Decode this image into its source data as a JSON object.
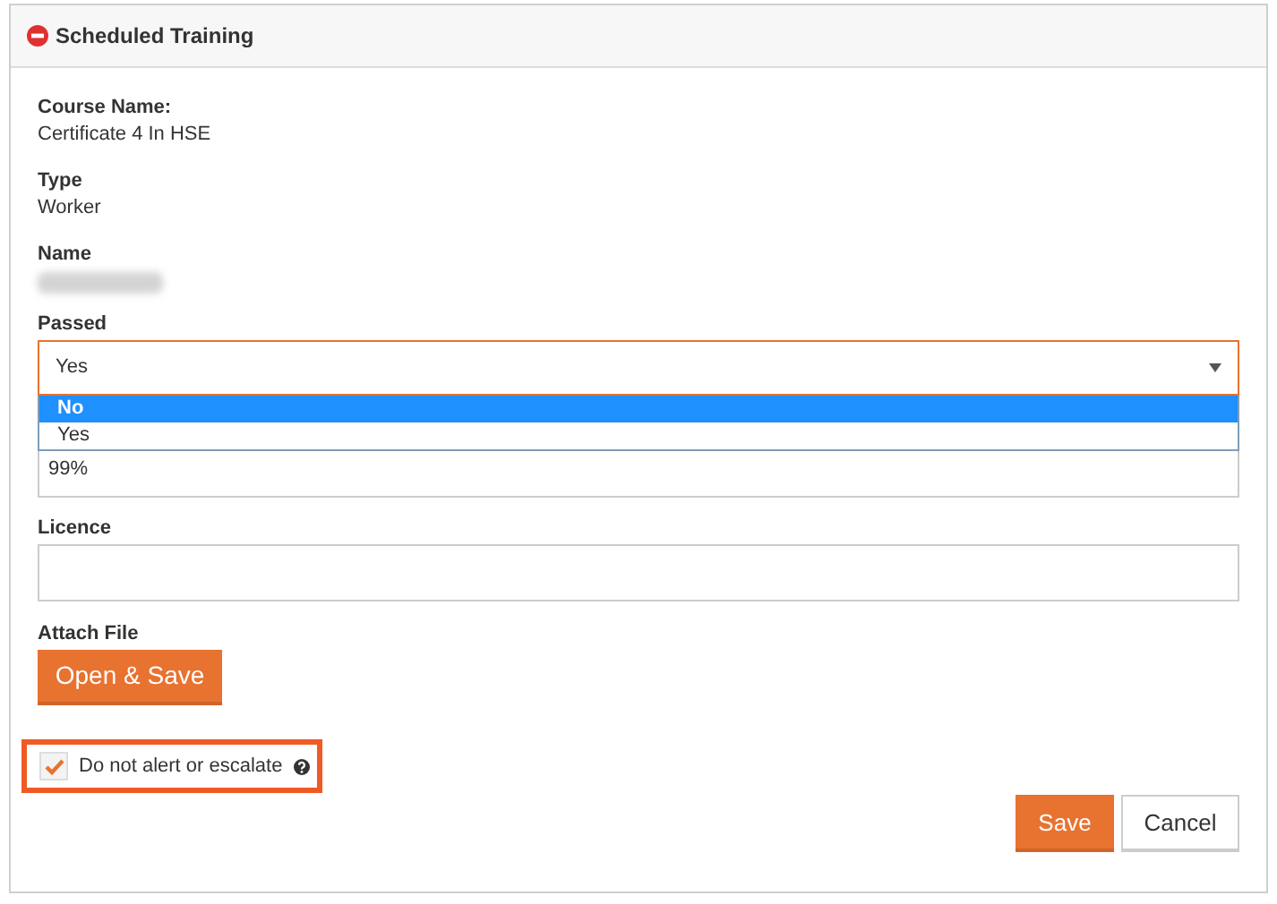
{
  "panel": {
    "title": "Scheduled Training"
  },
  "details": [
    {
      "label": "Course Name:",
      "value": "Certificate 4 In HSE",
      "redacted": false
    },
    {
      "label": "Type",
      "value": "Worker",
      "redacted": false
    },
    {
      "label": "Name",
      "redacted": true
    }
  ],
  "passed": {
    "label": "Passed",
    "value": "Yes",
    "expanded": true,
    "options": [
      {
        "label": "No",
        "highlighted": true
      },
      {
        "label": "Yes",
        "highlighted": false
      }
    ]
  },
  "score": {
    "value": "99%"
  },
  "licence": {
    "label": "Licence"
  },
  "attach": {
    "label": "Attach File",
    "button": "Open & Save"
  },
  "alert": {
    "label": "Do not alert or escalate",
    "checked": true,
    "highlighted": true
  },
  "buttons": [
    {
      "label": "Save",
      "kind": "primary"
    },
    {
      "label": "Cancel",
      "kind": "secondary"
    }
  ]
}
